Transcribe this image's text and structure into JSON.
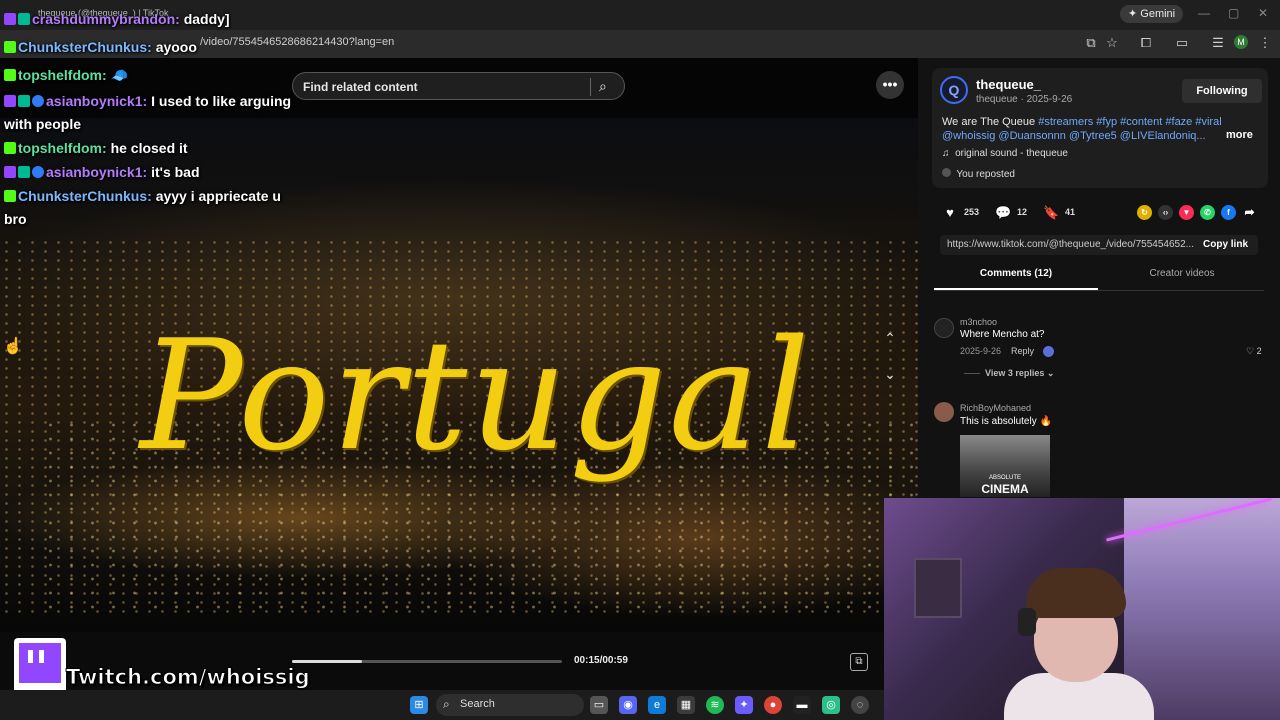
{
  "browser": {
    "tab_title": "thequeue (@thequeue_) | TikTok",
    "url": "/video/7554546528686214430?lang=en",
    "gemini_label": "Gemini",
    "profile_initial": "M"
  },
  "chat": [
    {
      "user": "crashdummybrandon",
      "text": "daddy]",
      "color": "purple",
      "badges": [
        "twitch",
        "sub"
      ]
    },
    {
      "user": "ChunksterChunkus",
      "text": "ayooo",
      "color": "blue",
      "badges": [
        "kick"
      ]
    },
    {
      "user": "topshelfdom",
      "text": "🧢",
      "color": "green",
      "badges": [
        "kick"
      ]
    },
    {
      "user": "asianboynick1",
      "text": "I used to like arguing with people",
      "color": "purple",
      "badges": [
        "twitch",
        "sub",
        "ver"
      ]
    },
    {
      "user": "topshelfdom",
      "text": "he closed it",
      "color": "green",
      "badges": [
        "kick"
      ]
    },
    {
      "user": "asianboynick1",
      "text": "it's bad",
      "color": "purple",
      "badges": [
        "twitch",
        "sub",
        "ver"
      ]
    },
    {
      "user": "ChunksterChunkus",
      "text": "ayyy i appriecate u bro",
      "color": "blue",
      "badges": [
        "kick"
      ]
    }
  ],
  "video": {
    "search_placeholder": "Find related content",
    "overlay_text": "Portugal",
    "time": "00:15/00:59",
    "progress": 0.26
  },
  "post": {
    "channel_name": "thequeue_",
    "channel_sub": "thequeue · 2025-9-26",
    "follow_label": "Following",
    "desc_plain": "We are The Queue ",
    "desc_tags_1": "#streamers #fyp #content #faze #viral",
    "desc_tags_2": "@whoissig @Duansonnn @Tytree5 @LIVElandoniq...",
    "more_label": "more",
    "sound": "original sound - thequeue",
    "reposted": "You reposted",
    "likes": "253",
    "comments": "12",
    "saves": "41",
    "link": "https://www.tiktok.com/@thequeue_/video/755454652...",
    "copy_label": "Copy link"
  },
  "tabs": {
    "comments": "Comments (12)",
    "creator": "Creator videos"
  },
  "comments_list": [
    {
      "user": "m3nchoo",
      "text": "Where Mencho at?",
      "date": "2025-9-26",
      "reply": "Reply",
      "likes": "2",
      "view_replies": "View 3 replies"
    },
    {
      "user": "RichBoyMohaned",
      "text": "This is absolutely 🔥",
      "image_caption_small": "ABSOLUTE",
      "image_caption_big": "CINEMA"
    }
  ],
  "watermark": {
    "text": "Twitch.com/whoissig"
  },
  "taskbar": {
    "search_label": "Search"
  }
}
